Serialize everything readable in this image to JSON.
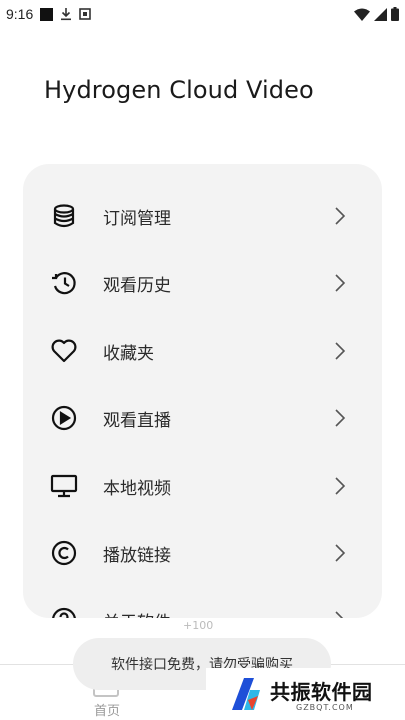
{
  "status_bar": {
    "time": "9:16",
    "icons": [
      "notification-square-icon",
      "download-icon",
      "screenshot-icon",
      "wifi-icon",
      "signal-icon",
      "battery-icon"
    ]
  },
  "page": {
    "title": "Hydrogen Cloud Video"
  },
  "menu": {
    "items": [
      {
        "label": "订阅管理",
        "icon": "database-icon"
      },
      {
        "label": "观看历史",
        "icon": "history-icon"
      },
      {
        "label": "收藏夹",
        "icon": "heart-icon"
      },
      {
        "label": "观看直播",
        "icon": "play-circle-icon"
      },
      {
        "label": "本地视频",
        "icon": "monitor-icon"
      },
      {
        "label": "播放链接",
        "icon": "copyright-icon"
      },
      {
        "label": "关于软件",
        "icon": "help-circle-icon"
      }
    ]
  },
  "bottom_nav": {
    "home_label": "首页"
  },
  "toast": {
    "message": "软件接口免费，请勿受骗购买",
    "badge": "+100"
  },
  "watermark": {
    "name": "共振软件园",
    "domain": "GZBQT.COM"
  },
  "colors": {
    "card_background": "#f3f3f3",
    "icon_color": "#111111",
    "chevron_color": "#555555"
  }
}
